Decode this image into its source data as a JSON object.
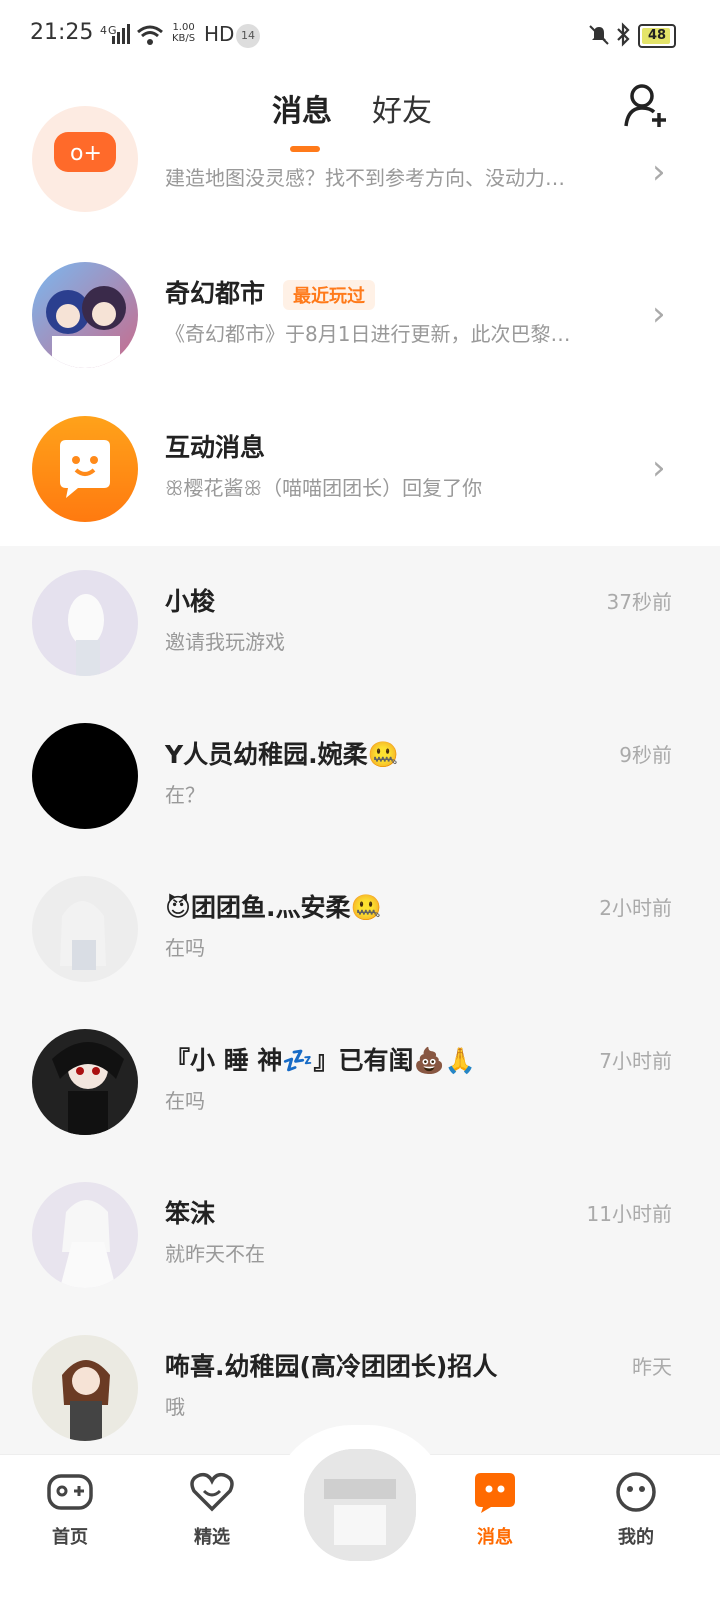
{
  "status": {
    "time": "21:25",
    "network": "4G",
    "speed_top": "1.00",
    "speed_bottom": "KB/S",
    "hd": "HD",
    "notif_count": "14",
    "battery": "48"
  },
  "header": {
    "tab_messages": "消息",
    "tab_friends": "好友",
    "add_friend_icon": "person-plus-icon"
  },
  "pinned": [
    {
      "title": "",
      "subtitle": "建造地图没灵感？找不到参考方向、没动力…",
      "icon": "game-controller-icon"
    },
    {
      "title": "奇幻都市",
      "tag": "最近玩过",
      "subtitle": "《奇幻都市》于8月1日进行更新，此次巴黎…"
    },
    {
      "title": "互动消息",
      "subtitle": "ꕥ樱花酱ꕥ（喵喵团团长）回复了你",
      "icon": "chat-bubble-face-icon"
    }
  ],
  "chats": [
    {
      "name": "小梭",
      "preview": "邀请我玩游戏",
      "time": "37秒前"
    },
    {
      "name": "Y人员幼稚园.婉柔🤐",
      "preview": "在？",
      "time": "9秒前"
    },
    {
      "name": "😈团团鱼.灬安柔🤐",
      "preview": "在吗",
      "time": "2小时前"
    },
    {
      "name": "『小 睡 神💤』已有闺💩🙏",
      "preview": "在吗",
      "time": "7小时前"
    },
    {
      "name": "笨沫",
      "preview": "就昨天不在",
      "time": "11小时前"
    },
    {
      "name": "咘喜.幼稚园(高冷团团长)招人",
      "preview": "哦",
      "time": "昨天"
    }
  ],
  "nav": {
    "home": "首页",
    "featured": "精选",
    "messages": "消息",
    "mine": "我的"
  },
  "colors": {
    "accent": "#ff7a1a",
    "tag_bg": "#fff1e6"
  }
}
